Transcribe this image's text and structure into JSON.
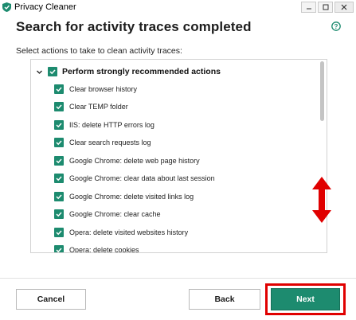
{
  "window": {
    "title": "Privacy Cleaner",
    "controls": [
      "minimize-icon",
      "maximize-icon",
      "close-icon"
    ]
  },
  "header": {
    "title": "Search for activity traces completed",
    "help_icon": "help-icon"
  },
  "instructions": "Select actions to take to clean activity traces:",
  "actions": {
    "group_label": "Perform strongly recommended actions",
    "group_checked": true,
    "items": [
      {
        "label": "Clear browser history",
        "checked": true
      },
      {
        "label": "Clear TEMP folder",
        "checked": true
      },
      {
        "label": "IIS: delete HTTP errors log",
        "checked": true
      },
      {
        "label": "Clear search requests log",
        "checked": true
      },
      {
        "label": "Google Chrome: delete web page history",
        "checked": true
      },
      {
        "label": "Google Chrome: clear data about last session",
        "checked": true
      },
      {
        "label": "Google Chrome: delete visited links log",
        "checked": true
      },
      {
        "label": "Google Chrome: clear cache",
        "checked": true
      },
      {
        "label": "Opera: delete visited websites history",
        "checked": true
      },
      {
        "label": "Opera: delete cookies",
        "checked": true
      }
    ]
  },
  "footer": {
    "cancel_label": "Cancel",
    "back_label": "Back",
    "next_label": "Next"
  },
  "colors": {
    "accent": "#1d8b6f",
    "annotation": "#e00000"
  }
}
